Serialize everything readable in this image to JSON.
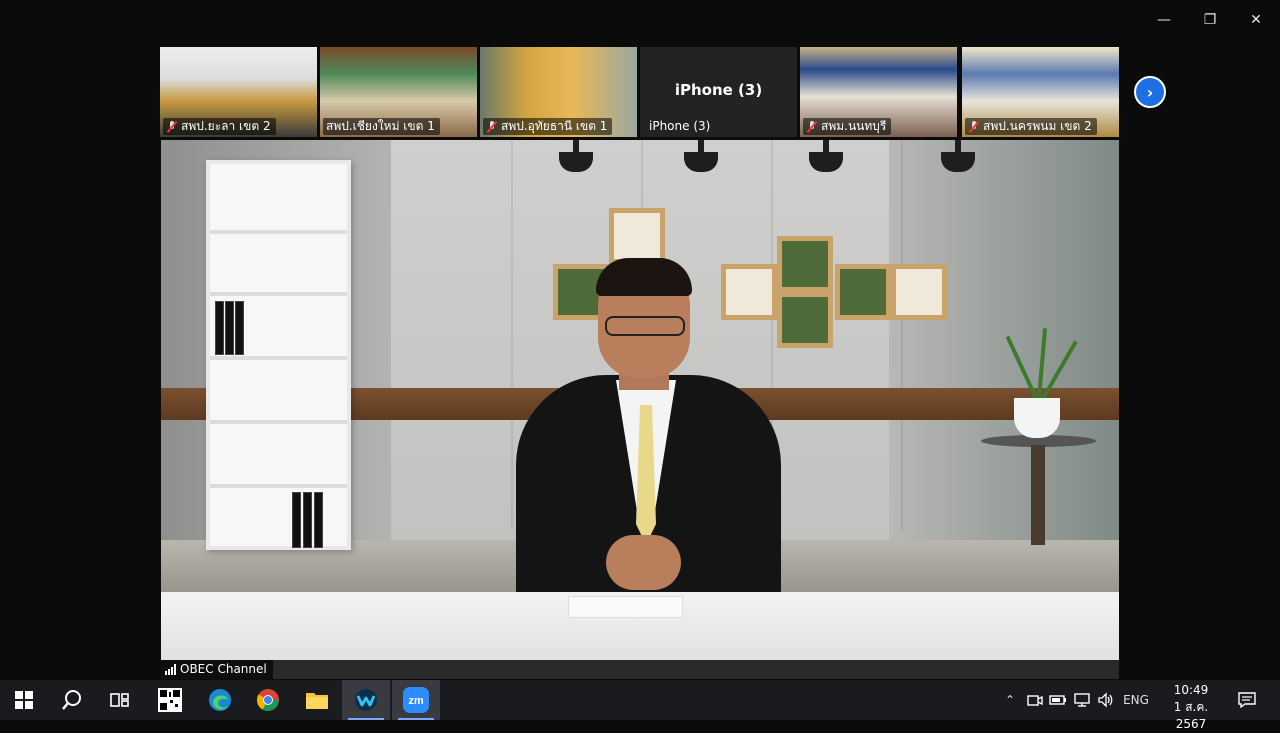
{
  "window": {
    "controls": {
      "minimize": "—",
      "maximize": "❐",
      "close": "✕"
    }
  },
  "thumbnails": [
    {
      "label": "สพป.ยะลา เขต 2",
      "muted": true
    },
    {
      "label": "สพป.เชียงใหม่ เขต 1",
      "muted": false
    },
    {
      "label": "สพป.อุทัยธานี เขต 1",
      "muted": true
    },
    {
      "label": "iPhone (3)",
      "center_name": "iPhone (3)",
      "muted": false
    },
    {
      "label": "สพม.นนทบุรี",
      "muted": true
    },
    {
      "label": "สพป.นครพนม เขต 2",
      "muted": true
    }
  ],
  "main_video": {
    "name": "OBEC Channel"
  },
  "taskbar": {
    "tray": {
      "lang": "ENG"
    },
    "clock": {
      "time": "10:49",
      "date": "1 ส.ค. 2567"
    }
  },
  "colors": {
    "accent": "#1d6fe6",
    "taskbar": "#1a1b1f",
    "muted": "#e23b3b"
  }
}
